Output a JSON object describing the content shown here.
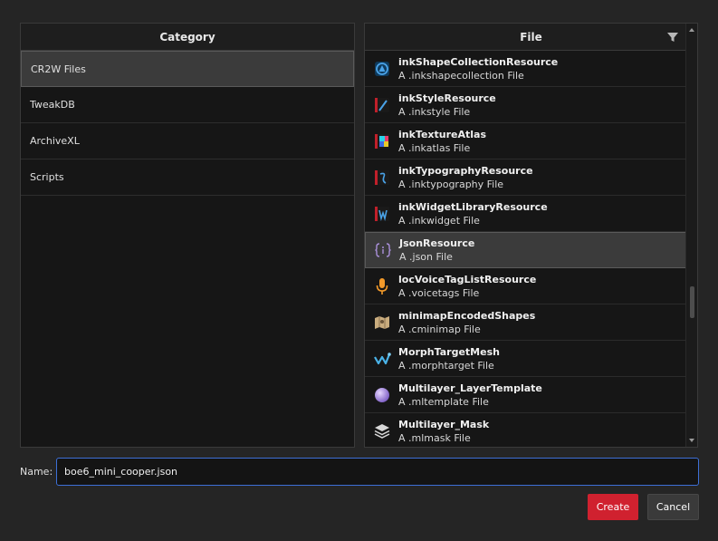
{
  "category_panel": {
    "header": "Category",
    "items": [
      {
        "label": "CR2W Files",
        "selected": true
      },
      {
        "label": "TweakDB",
        "selected": false
      },
      {
        "label": "ArchiveXL",
        "selected": false
      },
      {
        "label": "Scripts",
        "selected": false
      }
    ]
  },
  "file_panel": {
    "header": "File",
    "filter_icon": "filter-icon",
    "items": [
      {
        "name": "inkShapeCollectionResource",
        "desc": "A .inkshapecollection File",
        "icon": "ink-shape-collection-icon",
        "selected": false
      },
      {
        "name": "inkStyleResource",
        "desc": "A .inkstyle File",
        "icon": "ink-style-icon",
        "selected": false
      },
      {
        "name": "inkTextureAtlas",
        "desc": "A .inkatlas File",
        "icon": "ink-texture-atlas-icon",
        "selected": false
      },
      {
        "name": "inkTypographyResource",
        "desc": "A .inktypography File",
        "icon": "ink-typography-icon",
        "selected": false
      },
      {
        "name": "inkWidgetLibraryResource",
        "desc": "A .inkwidget File",
        "icon": "ink-widget-icon",
        "selected": false
      },
      {
        "name": "JsonResource",
        "desc": "A .json File",
        "icon": "json-icon",
        "selected": true
      },
      {
        "name": "locVoiceTagListResource",
        "desc": "A .voicetags File",
        "icon": "microphone-icon",
        "selected": false
      },
      {
        "name": "minimapEncodedShapes",
        "desc": "A .cminimap File",
        "icon": "map-icon",
        "selected": false
      },
      {
        "name": "MorphTargetMesh",
        "desc": "A .morphtarget File",
        "icon": "morph-target-icon",
        "selected": false
      },
      {
        "name": "Multilayer_LayerTemplate",
        "desc": "A .mltemplate File",
        "icon": "sphere-icon",
        "selected": false
      },
      {
        "name": "Multilayer_Mask",
        "desc": "A .mlmask File",
        "icon": "layers-icon",
        "selected": false
      }
    ]
  },
  "name_field": {
    "label": "Name:",
    "value": "boe6_mini_cooper.json"
  },
  "buttons": {
    "create": "Create",
    "cancel": "Cancel"
  },
  "colors": {
    "background": "#252525",
    "panel": "#161616",
    "selected": "#3b3b3b",
    "create_button": "#d0212f",
    "input_focus_border": "#3d6fd6"
  }
}
